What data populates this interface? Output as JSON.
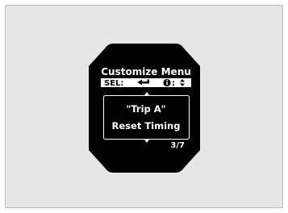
{
  "screen": {
    "menu_title": "Customize Menu",
    "sel_label": "SEL:",
    "sel_icon": "enter-arrow-icon",
    "info_label": ":",
    "info_icon": "info-icon",
    "updown_icon": "up-down-icon",
    "item_line1": "\"Trip A\"",
    "item_line2": "Reset Timing",
    "page_indicator": "3/7",
    "colors": {
      "background": "#e6e6e6",
      "display": "#000000",
      "text": "#ffffff"
    }
  }
}
